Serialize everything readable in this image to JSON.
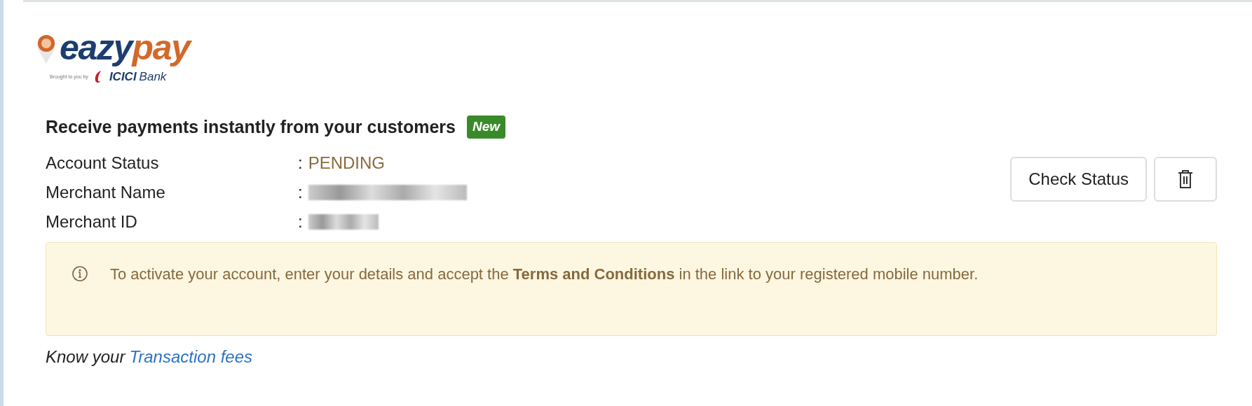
{
  "logo": {
    "name_dark": "eazy",
    "name_light": "pay",
    "tagline": "Brought to you by",
    "bank": "ICICI",
    "bank_suffix": "Bank"
  },
  "heading": {
    "title": "Receive payments instantly from your customers",
    "badge": "New"
  },
  "details": [
    {
      "label": "Account Status",
      "kind": "status",
      "value": "PENDING"
    },
    {
      "label": "Merchant Name",
      "kind": "redacted"
    },
    {
      "label": "Merchant ID",
      "kind": "redacted"
    }
  ],
  "separator": ":",
  "buttons": {
    "check_status": "Check Status"
  },
  "notice": {
    "text": "To activate your account, enter your details and accept the **Terms and Conditions** in the link to your registered mobile number."
  },
  "footer": {
    "prefix": "Know your",
    "link": "Transaction fees"
  }
}
